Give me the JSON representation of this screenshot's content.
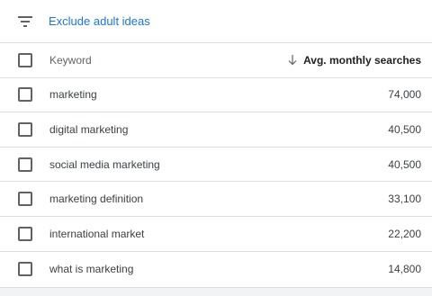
{
  "filter": {
    "link_label": "Exclude adult ideas"
  },
  "table": {
    "headers": {
      "keyword": "Keyword",
      "searches": "Avg. monthly searches"
    },
    "rows": [
      {
        "keyword": "marketing",
        "searches": "74,000"
      },
      {
        "keyword": "digital marketing",
        "searches": "40,500"
      },
      {
        "keyword": "social media marketing",
        "searches": "40,500"
      },
      {
        "keyword": "marketing definition",
        "searches": "33,100"
      },
      {
        "keyword": "international market",
        "searches": "22,200"
      },
      {
        "keyword": "what is marketing",
        "searches": "14,800"
      }
    ]
  },
  "icons": {
    "filter": "filter-icon",
    "sort": "arrow-down-icon",
    "checkbox": "checkbox-icon"
  },
  "colors": {
    "link": "#1a73e8",
    "border": "#e0e0e0",
    "text": "#3c4043"
  }
}
